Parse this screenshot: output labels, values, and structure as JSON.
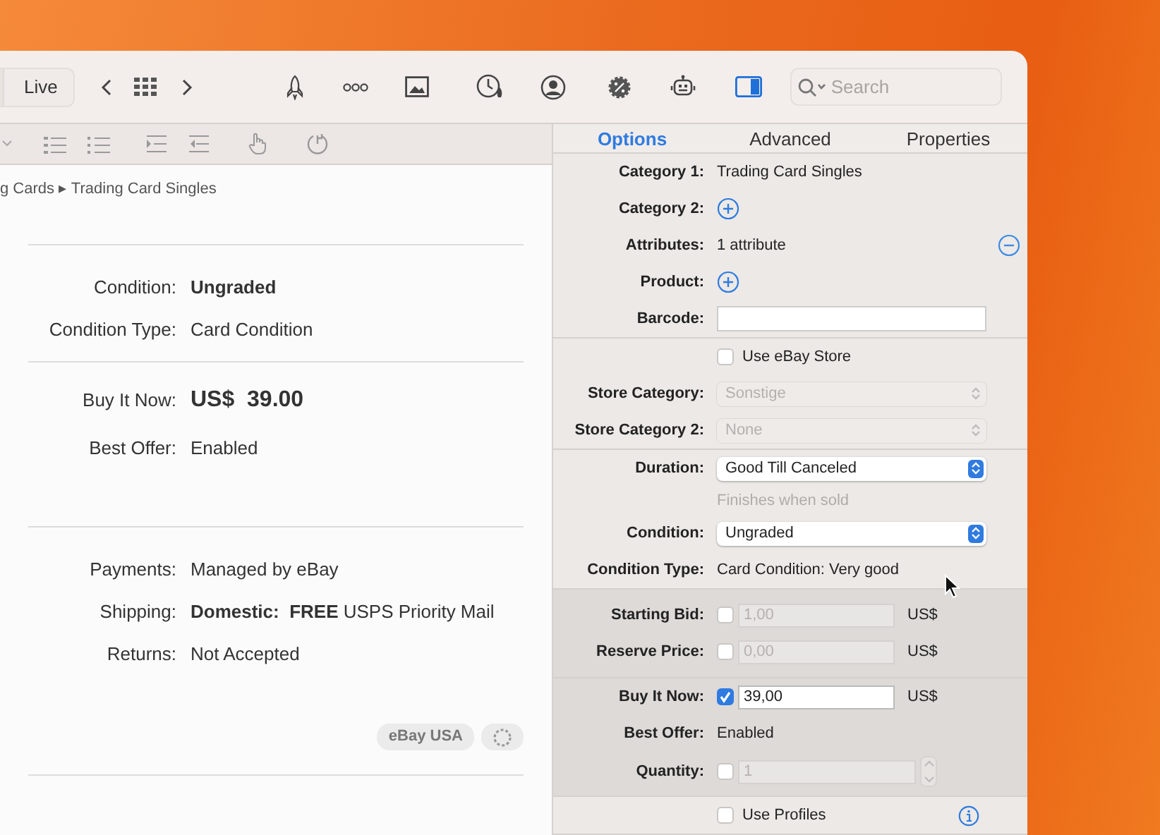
{
  "toolbar": {
    "live_button": "Live",
    "search": {
      "placeholder": "Search"
    }
  },
  "breadcrumb": "g Cards ▸ Trading Card Singles",
  "detail_groups": [
    [
      {
        "label": "Condition:",
        "value": "Ungraded",
        "kind": "bold"
      },
      {
        "label": "Condition Type:",
        "value": "Card Condition",
        "kind": "plain"
      }
    ],
    [
      {
        "label": "Buy It Now:",
        "value": "US$  39.00",
        "kind": "price"
      },
      {
        "label": "Best Offer:",
        "value": "Enabled",
        "kind": "plain"
      }
    ],
    [
      {
        "label": "Payments:",
        "value": "Managed by eBay",
        "kind": "plain"
      },
      {
        "label": "Shipping:",
        "value": "**Domestic:  FREE** USPS Priority Mail",
        "kind": "plain"
      },
      {
        "label": "Returns:",
        "value": "Not Accepted",
        "kind": "plain"
      }
    ]
  ],
  "region_badge": "eBay USA",
  "tabs": [
    {
      "label": "Options",
      "selected": true
    },
    {
      "label": "Advanced",
      "selected": false
    },
    {
      "label": "Properties",
      "selected": false
    }
  ],
  "sections": [
    {
      "shaded": false,
      "rows": [
        {
          "kind": "text",
          "label": "Category 1:",
          "value": "Trading Card Singles"
        },
        {
          "kind": "add",
          "label": "Category 2:"
        },
        {
          "kind": "text",
          "label": "Attributes:",
          "value": "1 attribute",
          "removable": true
        },
        {
          "kind": "add",
          "label": "Product:"
        },
        {
          "kind": "field",
          "label": "Barcode:",
          "value": ""
        }
      ]
    },
    {
      "shaded": false,
      "rows": [
        {
          "kind": "checkbox",
          "text": "Use eBay Store",
          "checked": false
        },
        {
          "kind": "popup",
          "label": "Store Category:",
          "value": "Sonstige",
          "disabled": true
        },
        {
          "kind": "popup",
          "label": "Store Category 2:",
          "value": "None",
          "disabled": true
        }
      ]
    },
    {
      "shaded": false,
      "rows": [
        {
          "kind": "popup",
          "label": "Duration:",
          "value": "Good Till Canceled",
          "disabled": false
        },
        {
          "kind": "hint",
          "value": "Finishes when sold"
        },
        {
          "kind": "popup",
          "label": "Condition:",
          "value": "Ungraded",
          "disabled": false
        },
        {
          "kind": "text",
          "label": "Condition Type:",
          "value": "Card Condition: Very good"
        }
      ]
    },
    {
      "shaded": true,
      "rows": [
        {
          "kind": "price",
          "label": "Starting Bid:",
          "checked": false,
          "value": "1,00",
          "currency": "US$"
        },
        {
          "kind": "price",
          "label": "Reserve Price:",
          "checked": false,
          "value": "0,00",
          "currency": "US$"
        }
      ]
    },
    {
      "shaded": true,
      "rows": [
        {
          "kind": "price",
          "label": "Buy It Now:",
          "checked": true,
          "value": "39,00",
          "currency": "US$"
        },
        {
          "kind": "text",
          "label": "Best Offer:",
          "value": "Enabled"
        },
        {
          "kind": "quantity",
          "label": "Quantity:",
          "checked": false,
          "value": "1"
        }
      ]
    },
    {
      "shaded": false,
      "rows": [
        {
          "kind": "checkbox",
          "text": "Use Profiles",
          "checked": false,
          "info": true
        }
      ]
    }
  ]
}
